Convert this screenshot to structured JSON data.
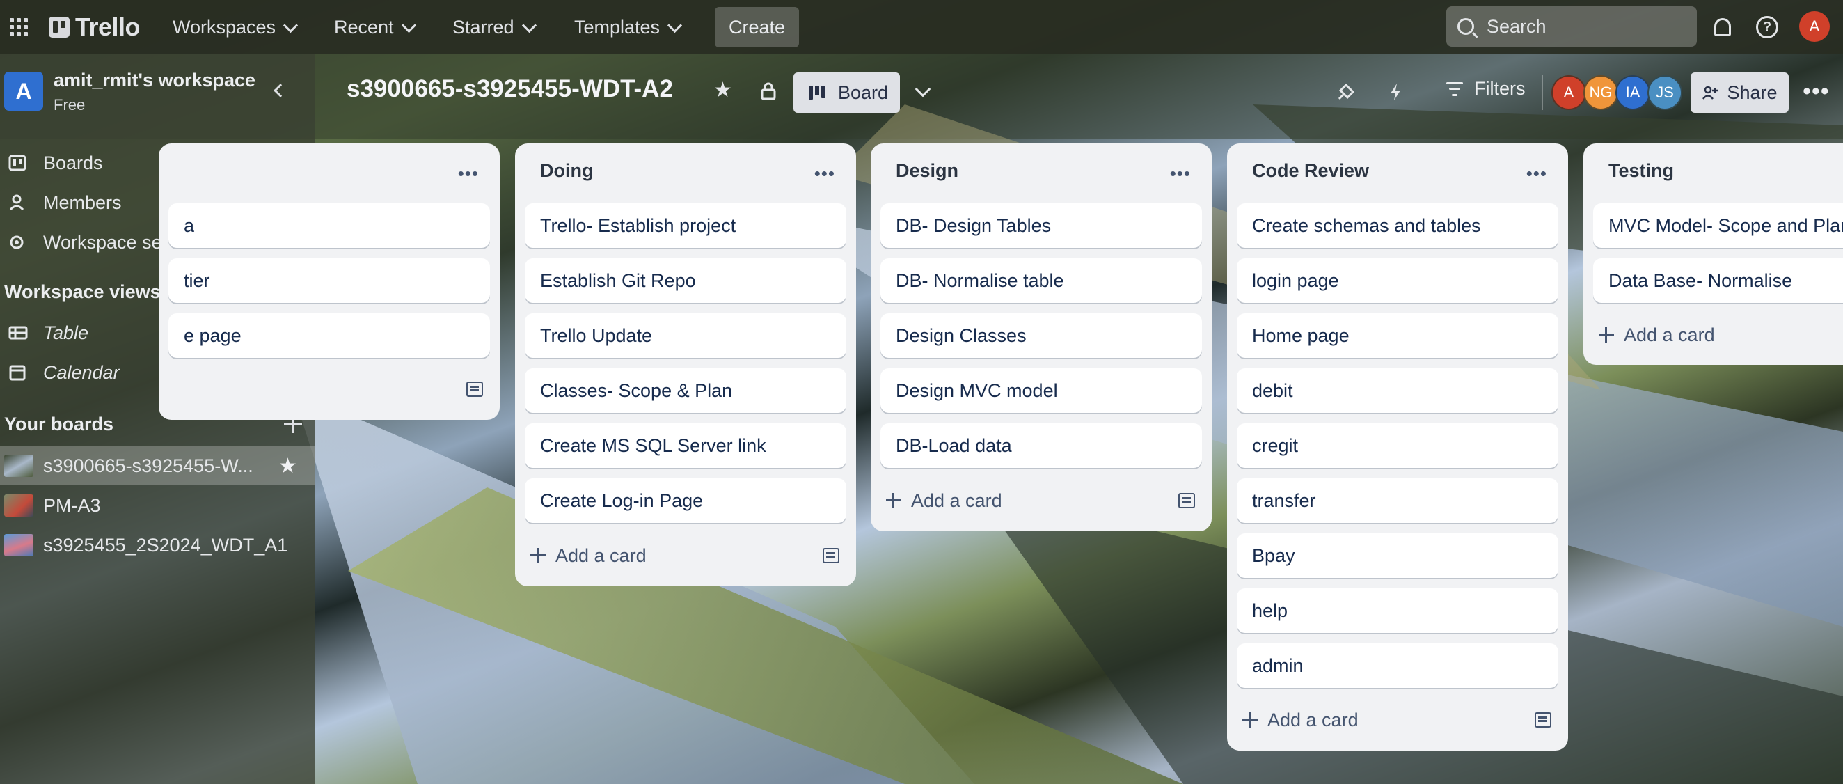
{
  "topbar": {
    "logo": "Trello",
    "nav": [
      "Workspaces",
      "Recent",
      "Starred",
      "Templates"
    ],
    "create_label": "Create",
    "search_placeholder": "Search",
    "user_initial": "A",
    "user_avatar_color": "#d0402a"
  },
  "sidebar": {
    "workspace_initial": "A",
    "workspace_name": "amit_rmit's workspace",
    "workspace_plan": "Free",
    "items": [
      {
        "label": "Boards",
        "icon": "trello-board-icon"
      },
      {
        "label": "Members",
        "icon": "person-icon"
      },
      {
        "label": "Workspace settings",
        "icon": "gear-icon"
      }
    ],
    "views_heading": "Workspace views",
    "views": [
      {
        "label": "Table",
        "icon": "table-icon"
      },
      {
        "label": "Calendar",
        "icon": "calendar-icon"
      }
    ],
    "boards_heading": "Your boards",
    "boards": [
      {
        "label": "s3900665-s3925455-W...",
        "active": true,
        "starred": true
      },
      {
        "label": "PM-A3",
        "active": false
      },
      {
        "label": "s3925455_2S2024_WDT_A1",
        "active": false
      }
    ]
  },
  "board": {
    "title": "s3900665-s3925455-WDT-A2",
    "view_label": "Board",
    "filters_label": "Filters",
    "share_label": "Share",
    "members": [
      {
        "initials": "A",
        "color": "#d0402a"
      },
      {
        "initials": "NG",
        "color": "#f0953a"
      },
      {
        "initials": "IA",
        "color": "#2f6fd0"
      },
      {
        "initials": "JS",
        "color": "#4a8fc2"
      }
    ]
  },
  "lists": [
    {
      "title": "",
      "cards": [
        "a",
        "tier",
        "e page"
      ],
      "add_label": ""
    },
    {
      "title": "Doing",
      "cards": [
        "Trello- Establish project",
        "Establish Git Repo",
        "Trello Update",
        "Classes- Scope & Plan",
        "Create MS SQL Server link",
        "Create Log-in Page"
      ],
      "add_label": "Add a card"
    },
    {
      "title": "Design",
      "cards": [
        "DB- Design Tables",
        "DB- Normalise table",
        "Design Classes",
        "Design MVC model",
        "DB-Load data"
      ],
      "add_label": "Add a card"
    },
    {
      "title": "Code Review",
      "cards": [
        "Create schemas and tables",
        "login page",
        "Home page",
        "debit",
        "cregit",
        "transfer",
        "Bpay",
        "help",
        "admin"
      ],
      "add_label": "Add a card"
    },
    {
      "title": "Testing",
      "cards": [
        "MVC Model- Scope and Plan",
        "Data Base- Normalise"
      ],
      "add_label": "Add a card"
    }
  ]
}
